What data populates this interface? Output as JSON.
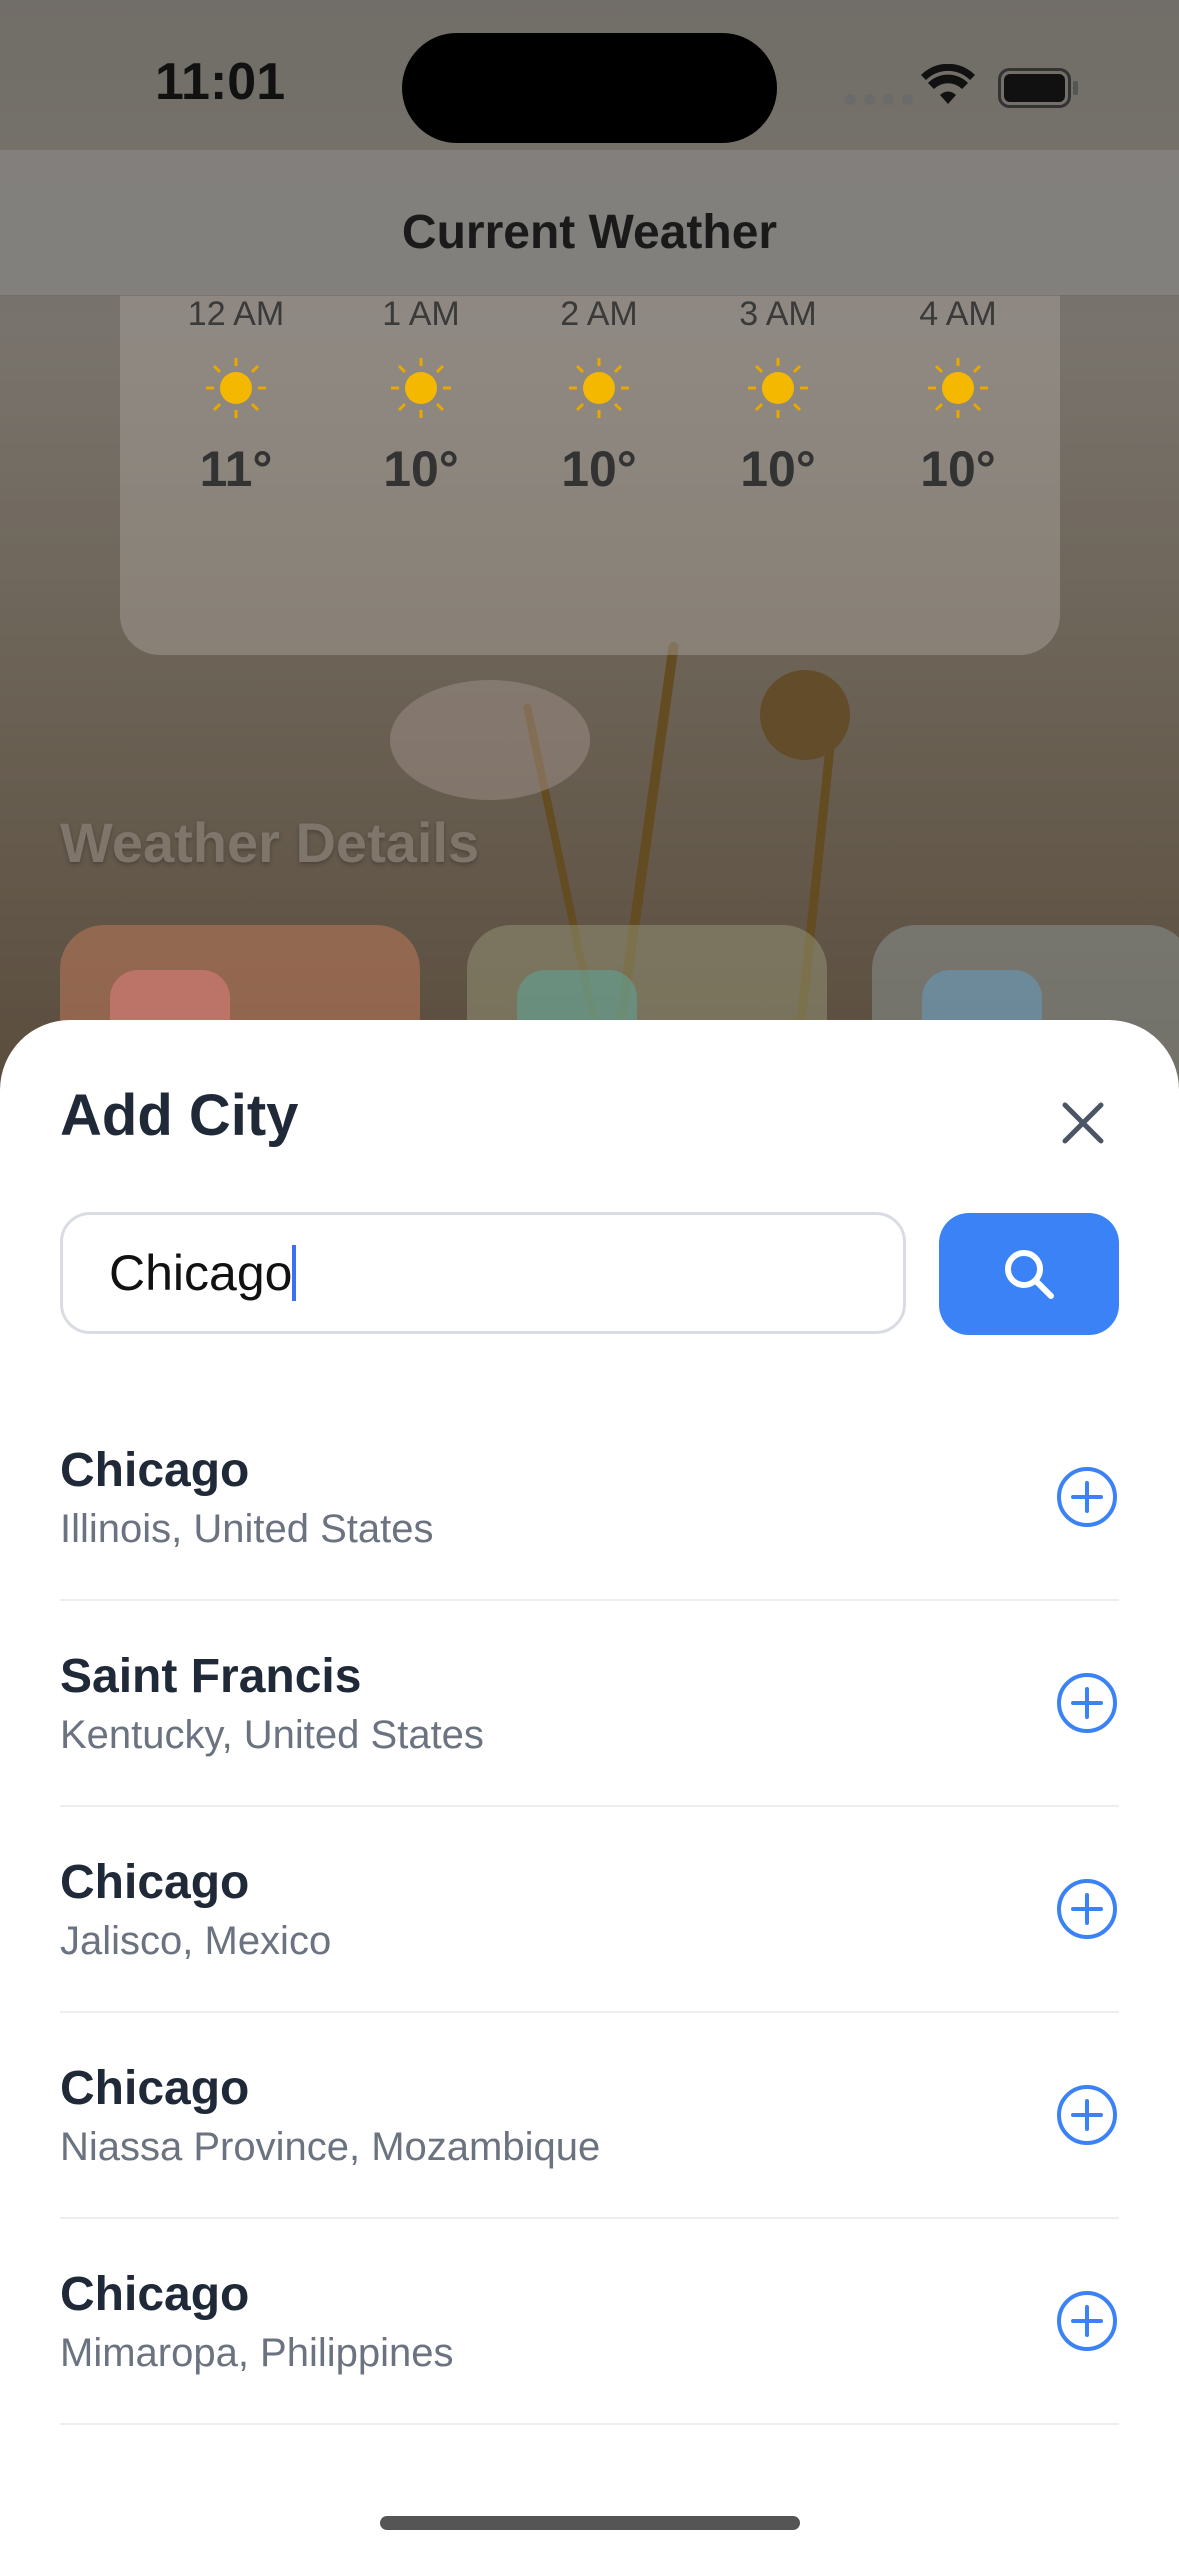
{
  "status_bar": {
    "time": "11:01"
  },
  "nav": {
    "title": "Current Weather"
  },
  "hourly": [
    {
      "label": "12 AM",
      "icon": "sun-icon",
      "temp": "11°"
    },
    {
      "label": "1 AM",
      "icon": "sun-icon",
      "temp": "10°"
    },
    {
      "label": "2 AM",
      "icon": "sun-icon",
      "temp": "10°"
    },
    {
      "label": "3 AM",
      "icon": "sun-icon",
      "temp": "10°"
    },
    {
      "label": "4 AM",
      "icon": "sun-icon",
      "temp": "10°"
    }
  ],
  "details": {
    "title": "Weather Details"
  },
  "sheet": {
    "title": "Add City",
    "close_icon": "close-icon",
    "search_value": "Chicago",
    "search_icon": "search-icon",
    "results": [
      {
        "city": "Chicago",
        "region": "Illinois, United States"
      },
      {
        "city": "Saint Francis",
        "region": "Kentucky, United States"
      },
      {
        "city": "Chicago",
        "region": "Jalisco, Mexico"
      },
      {
        "city": "Chicago",
        "region": "Niassa Province, Mozambique"
      },
      {
        "city": "Chicago",
        "region": "Mimaropa, Philippines"
      }
    ]
  },
  "colors": {
    "accent": "#3b82f6",
    "title": "#1f2937",
    "subtitle": "#6b7280"
  }
}
